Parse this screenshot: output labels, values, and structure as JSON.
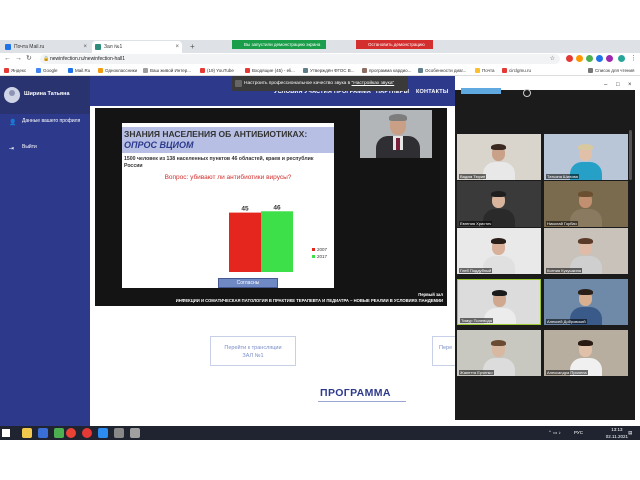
{
  "browser": {
    "tabs": [
      {
        "label": "Почта Mail.ru",
        "color": "#1e73e8",
        "active": false
      },
      {
        "label": "Зал №1",
        "color": "#2d8c7a",
        "active": true
      }
    ],
    "new_tab": "+",
    "share_notice": "Вы запустили демонстрацию экрана",
    "stop_share": "Остановить демонстрацию",
    "url": "newinfection.ru/newinfection-hall1",
    "bookmarks": [
      {
        "label": "Яндекс",
        "color": "#e53935"
      },
      {
        "label": "Google",
        "color": "#4285f4"
      },
      {
        "label": "Mail.Ru",
        "color": "#1e73e8"
      },
      {
        "label": "Одноклассники",
        "color": "#f39c12"
      },
      {
        "label": "Ваш живой Интер...",
        "color": "#9e9e9e"
      },
      {
        "label": "(19) YouTube",
        "color": "#e53935"
      },
      {
        "label": "Входящие (45) - eli...",
        "color": "#e53935"
      },
      {
        "label": "Утверждён ФГОС В...",
        "color": "#607d8b"
      },
      {
        "label": "программа кардио...",
        "color": "#8d6e63"
      },
      {
        "label": "Особенности диаг...",
        "color": "#607d8b"
      },
      {
        "label": "Почта",
        "color": "#fbc02d"
      },
      {
        "label": "circlgmu.ru",
        "color": "#e53935"
      }
    ],
    "reading_list": "Список для чтения"
  },
  "popup": {
    "text": "Настроить профессиональное качество звука в ",
    "link": "\"Настройках звука\""
  },
  "sidebar": {
    "user_name": "Ширина Татьяна",
    "items": [
      {
        "label": "Данные вашего профиля",
        "icon": "person-icon"
      },
      {
        "label": "Выйти",
        "icon": "logout-icon"
      }
    ]
  },
  "topnav": {
    "links": [
      "УСЛОВИЯ УЧАСТИЯ",
      "ПРОГРАММА",
      "ПАРТНЕРЫ",
      "КОНТАКТЫ"
    ]
  },
  "slide": {
    "title": "ЗНАНИЯ НАСЕЛЕНИЯ ОБ АНТИБИОТИКАХ:",
    "subtitle": "ОПРОС ВЦИОМ",
    "description": "1500 человек из 138 населенных пунктов 46 областей, краев и республик России",
    "question": "Вопрос: убивают ли антибиотики вирусы?",
    "answer_button": "Согласны"
  },
  "chart_data": {
    "type": "bar",
    "categories": [
      "Согласны"
    ],
    "series": [
      {
        "name": "2007",
        "values": [
          45
        ],
        "color": "#e5261f"
      },
      {
        "name": "2017",
        "values": [
          46
        ],
        "color": "#3ee04a"
      }
    ],
    "title": "Вопрос: убивают ли антибиотики вирусы?",
    "legend": "right"
  },
  "video": {
    "hall_label": "Первый зал",
    "banner": "ИНФЕКЦИИ И СОМАТИЧЕСКАЯ ПАТОЛОГИЯ В ПРАКТИКЕ ТЕРАПЕВТА И ПЕДИАТРА – НОВЫЕ РЕАЛИИ В УСЛОВИЯХ ПАНДЕМИИ"
  },
  "buttons": {
    "broadcast": "Перейти к трансляции\nЗАЛ №1",
    "broadcast_partial": "Пере"
  },
  "program_heading": "ПРОГРАММА",
  "participants": [
    {
      "name": "Вадим Тюрин",
      "bg": "#d9d4cc",
      "skin": "#c9a088",
      "hair": "#3a2a20",
      "shirt": "#e8e8e8"
    },
    {
      "name": "Татьяна Шилова",
      "bg": "#b9c6d8",
      "skin": "#e0c0a8",
      "hair": "#d8c9a0",
      "shirt": "#27a0c8"
    },
    {
      "name": "Евгения Христич",
      "bg": "#3a3a3a",
      "skin": "#d9b59e",
      "hair": "#1e1e1e",
      "shirt": "#2a2a2a"
    },
    {
      "name": "Николай Горбач",
      "bg": "#7a6a4e",
      "skin": "#c09070",
      "hair": "#6a5030",
      "shirt": "#8a7a60"
    },
    {
      "name": "Глеб Поддубный",
      "bg": "#e9e9e9",
      "skin": "#d9b09a",
      "hair": "#2a1e18",
      "shirt": "#e0e0e0"
    },
    {
      "name": "Ксения Кукушкина",
      "bg": "#c8c2ba",
      "skin": "#e0bca8",
      "hair": "#5a3a28",
      "shirt": "#cfcfcf"
    },
    {
      "name": "Тимур Полевода",
      "bg": "#dcdcdc",
      "skin": "#d0a890",
      "hair": "#1a1a1a",
      "shirt": "#ececec"
    },
    {
      "name": "Алексей Добровский",
      "bg": "#6e8aa8",
      "skin": "#d8b090",
      "hair": "#2a2018",
      "shirt": "#3a5a8a"
    },
    {
      "name": "Жанетта Ерченко",
      "bg": "#c8c8c0",
      "skin": "#d8b8a0",
      "hair": "#6a4a30",
      "shirt": "#dcdcdc"
    },
    {
      "name": "Александра Прилепа",
      "bg": "#b8aea0",
      "skin": "#e0c0a8",
      "hair": "#2a1a14",
      "shirt": "#f0f0f0"
    }
  ],
  "taskbar": {
    "tray_lang": "РУС",
    "time": "13:13",
    "date": "02.11.2021"
  },
  "colors": {
    "brand": "#2d3a8c",
    "accent_light": "#b7bfe4"
  }
}
